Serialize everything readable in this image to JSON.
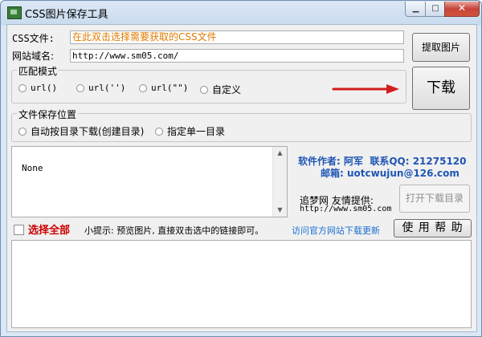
{
  "window": {
    "title": "CSS图片保存工具",
    "min_glyph": "▁",
    "max_glyph": "□",
    "close_glyph": "✕"
  },
  "form": {
    "css_file_label": "CSS文件:",
    "css_file_placeholder": "在此双击选择需要获取的CSS文件",
    "site_label": "网站域名:",
    "site_value": "http://www.sm05.com/",
    "extract_button": "提取图片",
    "download_button": "下载"
  },
  "match_mode": {
    "title": "匹配模式",
    "options": [
      "url()",
      "url('')",
      "url(\"\")",
      "自定义"
    ]
  },
  "save_location": {
    "title": "文件保存位置",
    "options": [
      "自动按目录下载(创建目录)",
      "指定单一目录"
    ]
  },
  "list": {
    "items": [
      "None"
    ]
  },
  "info": {
    "author": "软件作者: 阿军  联系QQ: 21275120",
    "email": "邮箱: uotcwujun@126.com",
    "friend_label": "追梦网 友情提供:",
    "friend_url": "http://www.sm05.com",
    "open_folder_button": "打开下载目录"
  },
  "bottom": {
    "select_all": "选择全部",
    "tip": "小提示: 预览图片, 直接双击选中的链接即可。",
    "update_link": "访问官方网站下载更新",
    "help_button": "使 用 帮 助"
  },
  "colors": {
    "placeholder": "#e07a00",
    "select_all": "#cc0000",
    "info_blue": "#1f56b4",
    "link_blue": "#1a6fd0",
    "arrow_red": "#d21e1e"
  }
}
